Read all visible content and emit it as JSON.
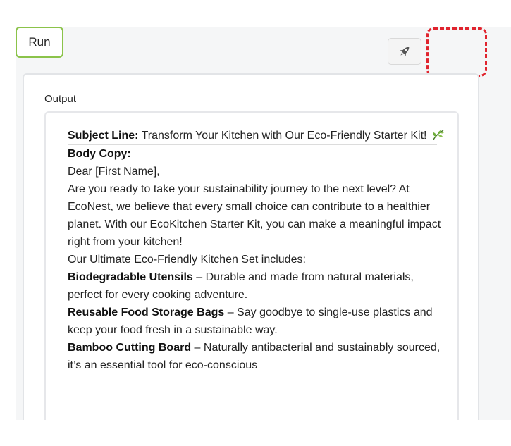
{
  "toolbar": {
    "rocket_icon": "rocket-icon",
    "run_label": "Run",
    "accent_green": "#8bc34a",
    "highlight_color": "#e0242e"
  },
  "output": {
    "label": "Output",
    "subject_label": "Subject Line:",
    "subject_text": " Transform Your Kitchen with Our Eco-Friendly Starter Kit!",
    "subject_icon": "leaf-icon",
    "body_heading": "Body Copy:",
    "greeting": "Dear [First Name],",
    "paragraph1": "Are you ready to take your sustainability journey to the next level? At EcoNest, we believe that every small choice can contribute to a healthier planet. With our EcoKitchen Starter Kit, you can make a meaningful impact right from your kitchen!",
    "set_intro": "Our Ultimate Eco-Friendly Kitchen Set includes:",
    "items": [
      {
        "name": "Biodegradable Utensils",
        "desc": " – Durable and made from natural materials, perfect for every cooking adventure."
      },
      {
        "name": "Reusable Food Storage Bags",
        "desc": " – Say goodbye to single-use plastics and keep your food fresh in a sustainable way."
      },
      {
        "name": "Bamboo Cutting Board",
        "desc": " – Naturally antibacterial and sustainably sourced, it’s an essential tool for eco-conscious"
      }
    ]
  }
}
